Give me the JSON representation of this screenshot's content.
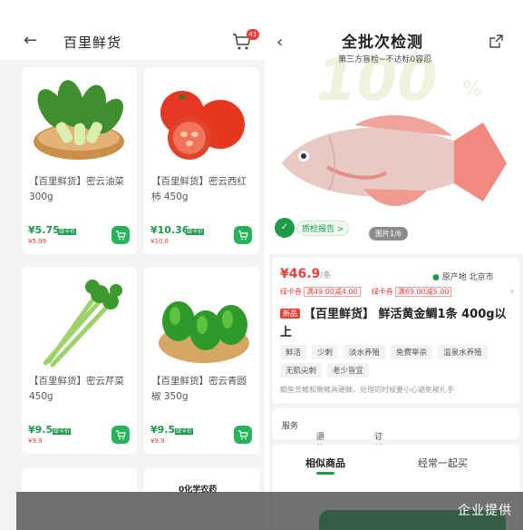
{
  "left": {
    "header": {
      "back_icon": "arrow-left-icon",
      "title": "百里鲜货",
      "cart_icon": "cart-icon",
      "cart_badge": "41"
    },
    "products": [
      {
        "name": "【百里鲜货】密云油菜 300g",
        "price": "¥5.75",
        "vip": "绿卡价",
        "old_price": "¥5.99",
        "image": "bok-choy"
      },
      {
        "name": "【百里鲜货】密云西红柿 450g",
        "price": "¥10.36",
        "vip": "绿卡价",
        "old_price": "¥10.8",
        "image": "tomato"
      },
      {
        "name": "【百里鲜货】密云芹菜 450g",
        "price": "¥9.5",
        "vip": "绿卡价",
        "old_price": "¥9.9",
        "image": "celery"
      },
      {
        "name": "【百里鲜货】密云青圆椒 350g",
        "price": "¥9.5",
        "vip": "绿卡价",
        "old_price": "¥9.9",
        "image": "green-pepper"
      }
    ],
    "peek_text": "0化学农药"
  },
  "right": {
    "hero": {
      "title": "全批次检测",
      "subtitle": "第三方盲检~不达标0容忍",
      "bg_number": "100",
      "bg_percent": "%",
      "report_label": "质检报告 >",
      "report_badge": "✓",
      "pic_count": "图片1/6"
    },
    "info": {
      "price": "¥46.9",
      "price_unit": "/条",
      "origin_label": "原产地 北京市",
      "coupons": [
        {
          "label": "绿卡券",
          "value": "满49.00减4.00"
        },
        {
          "label": "绿卡券",
          "value": "满69.00减5.00"
        }
      ],
      "new_tag": "新品",
      "title": "【百里鲜货】 鲜活黄金鲷1条 400g以上",
      "tags": [
        "鲜活",
        "少刺",
        "淡水养殖",
        "免费宰杀",
        "温泉水养殖",
        "无肌尖刺",
        "老少皆宜"
      ],
      "note": "鲷鱼背鳍和臀鳍具硬棘，处理的时候要小心避免被扎手"
    },
    "service": {
      "label": "服务",
      "item1": "退款说明",
      "item2": "订单取消说明"
    },
    "tabs": {
      "active": "相似商品",
      "inactive": "经常一起买"
    }
  },
  "overlay_text": "企业提供"
}
